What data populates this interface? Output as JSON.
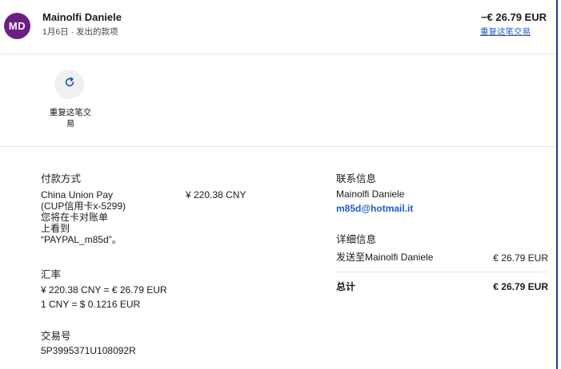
{
  "header": {
    "avatar_initials": "MD",
    "name": "Mainolfi Daniele",
    "subline": "1月6日 · 发出的款项",
    "amount": "−€ 26.79 EUR",
    "repeat_link": "重复这笔交易"
  },
  "actions": {
    "repeat_icon": "refresh-icon",
    "repeat_label": "重复这笔交\n易"
  },
  "payment": {
    "title": "付款方式",
    "method": "China Union Pay\n(CUP信用卡x-5299)\n您将在卡对账单\n上看到\n“PAYPAL_m85d”。",
    "amount": "¥ 220.38 CNY"
  },
  "exchange": {
    "title": "汇率",
    "line1": "¥ 220.38 CNY = € 26.79 EUR",
    "line2": "1 CNY = $ 0.1216 EUR"
  },
  "transaction": {
    "title": "交易号",
    "id": "5P3995371U108092R"
  },
  "contact": {
    "title": "联系信息",
    "name": "Mainolfi Daniele",
    "email": "m85d@hotmail.it"
  },
  "details": {
    "title": "详细信息",
    "sent_to": "发送至Mainolfi Daniele",
    "sent_amount": "€ 26.79 EUR",
    "total_label": "总计",
    "total_amount": "€ 26.79 EUR"
  },
  "colors": {
    "avatar_bg": "#6b1e84",
    "link": "#1f5ccf",
    "border_accent": "#1f3d8c"
  }
}
